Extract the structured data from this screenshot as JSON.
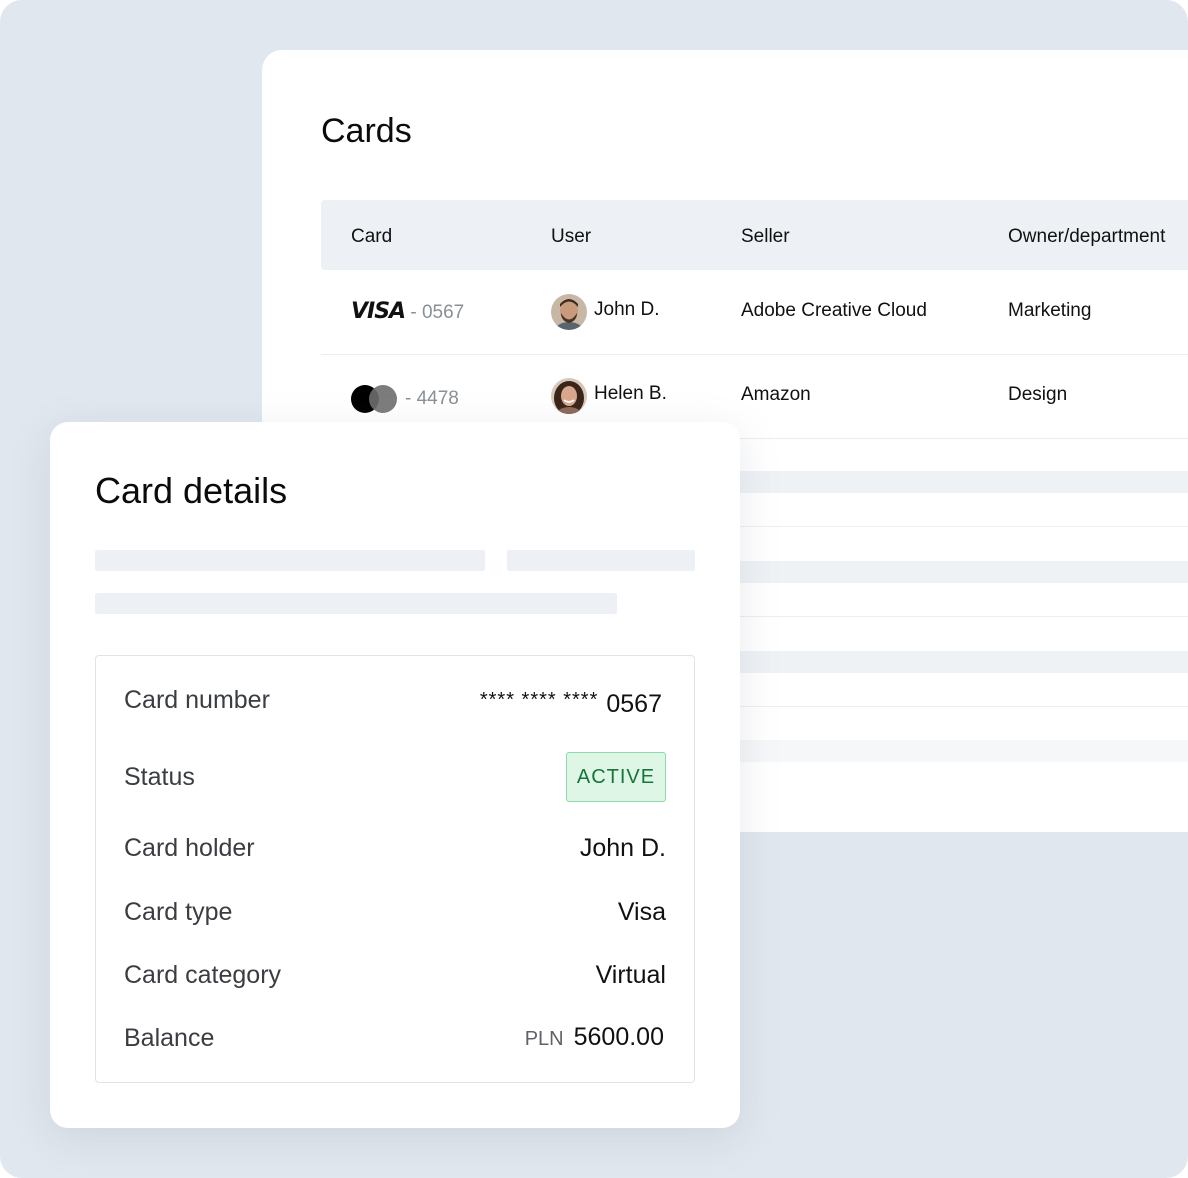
{
  "cards_panel": {
    "title": "Cards",
    "columns": [
      "Card",
      "User",
      "Seller",
      "Owner/department"
    ],
    "rows": [
      {
        "brand": "VISA",
        "last4": "- 0567",
        "user": "John D.",
        "seller": "Adobe Creative Cloud",
        "department": "Marketing"
      },
      {
        "brand": "Mastercard",
        "last4": "- 4478",
        "user": "Helen B.",
        "seller": "Amazon",
        "department": "Design"
      }
    ]
  },
  "card_details": {
    "title": "Card details",
    "fields": {
      "card_number": {
        "label": "Card number",
        "masked": "**** **** ****",
        "last4": "0567"
      },
      "status": {
        "label": "Status",
        "value": "ACTIVE",
        "color": "#16753a"
      },
      "card_holder": {
        "label": "Card holder",
        "value": "John D."
      },
      "card_type": {
        "label": "Card type",
        "value": "Visa"
      },
      "card_category": {
        "label": "Card category",
        "value": "Virtual"
      },
      "balance": {
        "label": "Balance",
        "currency": "PLN",
        "value": "5600.00"
      }
    }
  },
  "colors": {
    "background": "#e1e7ee",
    "table_header": "#edf1f5",
    "badge_bg": "#ddf6e6",
    "badge_border": "#8fd9a8"
  },
  "icons": {
    "visa": "visa-logo-icon",
    "mastercard": "mastercard-logo-icon",
    "avatar_john": "avatar-john-icon",
    "avatar_helen": "avatar-helen-icon"
  }
}
